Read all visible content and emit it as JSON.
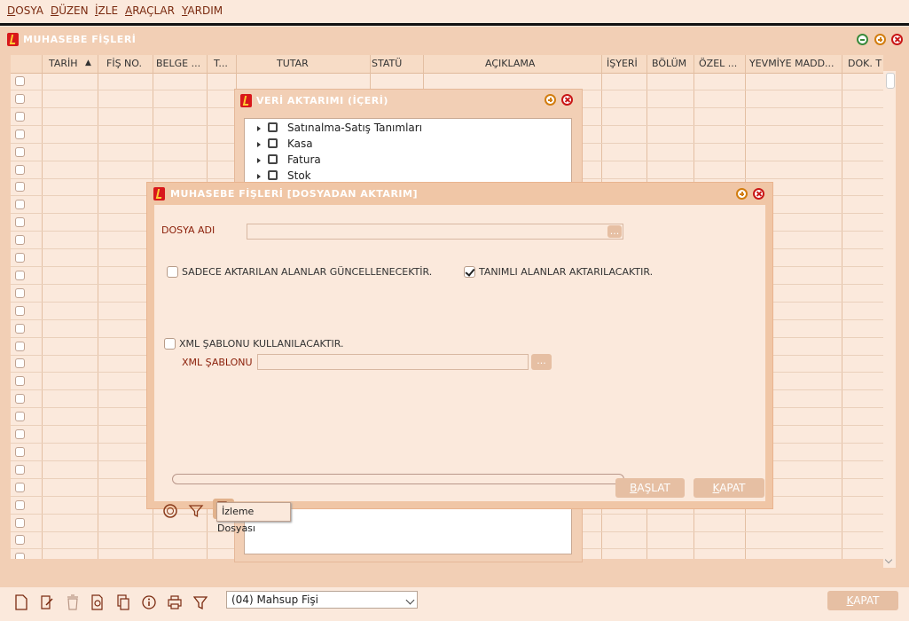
{
  "menu": [
    "DOSYA",
    "DÜZEN",
    "İZLE",
    "ARAÇLAR",
    "YARDIM"
  ],
  "main_window": {
    "title": "MUHASEBE FİŞLERİ"
  },
  "columns": [
    "TARİH",
    "FİŞ NO.",
    "BELGE ...",
    "T...",
    "TUTAR",
    "STATÜ",
    "AÇIKLAMA",
    "İŞYERİ",
    "BÖLÜM",
    "ÖZEL ...",
    "YEVMİYE MADD...",
    "DOK. T"
  ],
  "sort_indicator": "▲",
  "import_window": {
    "title": "VERİ AKTARIMI (İÇERİ)",
    "tree": [
      "Satınalma-Satış Tanımları",
      "Kasa",
      "Fatura",
      "Stok"
    ]
  },
  "dialog": {
    "title": "MUHASEBE FİŞLERİ [DOSYADAN AKTARIM]",
    "file_label": "DOSYA ADI",
    "ellipsis": "...",
    "only_update_label": "SADECE AKTARILAN ALANLAR GÜNCELLENECEKTİR.",
    "defined_fields_label": "TANIMLI ALANLAR AKTARILACAKTIR.",
    "xml_use_label": "XML ŞABLONU KULLANILACAKTIR.",
    "xml_template_label": "XML ŞABLONU",
    "start_button": "BAŞLAT",
    "close_button": "KAPAT",
    "tooltip": "İzleme Dosyası",
    "only_update_checked": false,
    "defined_fields_checked": true,
    "xml_use_checked": false
  },
  "bottom": {
    "combo_value": "(04) Mahsup Fişi",
    "close_button": "KAPAT"
  }
}
